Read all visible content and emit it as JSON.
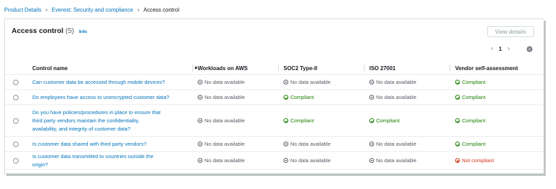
{
  "breadcrumb": {
    "items": [
      "Product Details",
      "Everest: Security and compliance",
      "Access control"
    ]
  },
  "panel": {
    "title": "Access control",
    "count": "(5)",
    "info": "Info",
    "view_button": "View details",
    "page": "1"
  },
  "table": {
    "columns": [
      "Control name",
      "Workloads on AWS",
      "SOC2 Type-II",
      "ISO 27001",
      "Vendor self-assessment"
    ],
    "rows": [
      {
        "control_lines": [
          "Can customer data be accessed through mobile devices?"
        ],
        "cells": [
          "No data available",
          "No data available",
          "No data available",
          "Compliant"
        ]
      },
      {
        "control_lines": [
          "Do employees have access to unencrypted customer data?"
        ],
        "cells": [
          "No data available",
          "Compliant",
          "No data available",
          "Compliant"
        ]
      },
      {
        "control_lines": [
          "Do you have policies/procedures in place to ensure that",
          "third party vendors maintain the confidentiality,",
          "availability, and integrity of customer data?"
        ],
        "cells": [
          "No data available",
          "Compliant",
          "Compliant",
          "Compliant"
        ]
      },
      {
        "control_lines": [
          "Is customer data shared with third party vendors?"
        ],
        "cells": [
          "No data available",
          "No data available",
          "No data available",
          "Compliant"
        ]
      },
      {
        "control_lines": [
          "Is customer data transmitted to countries outside the",
          "origin?"
        ],
        "cells": [
          "No data available",
          "No data available",
          "No data available",
          "Not compliant"
        ]
      }
    ]
  },
  "icons": {
    "no_data": "minus-circle-icon",
    "compliant": "check-circle-icon",
    "not_compliant": "x-circle-icon",
    "settings": "gear-icon",
    "sort": "sort-ascending-icon"
  },
  "colors": {
    "link": "#0073bb",
    "compliant": "#1d8102",
    "not_compliant": "#d13212",
    "no_data": "#545b64"
  }
}
